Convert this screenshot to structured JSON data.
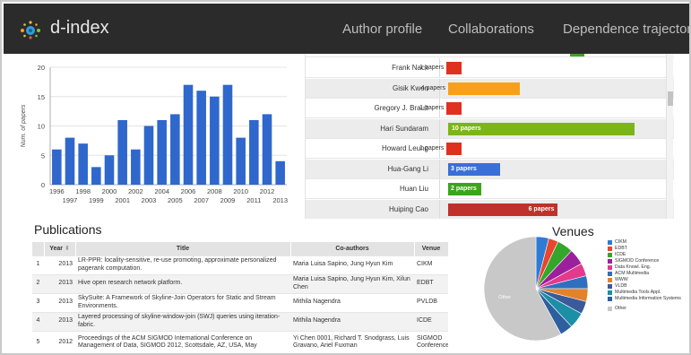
{
  "app": {
    "name": "d-index",
    "nav": [
      "Author profile",
      "Collaborations",
      "Dependence trajectory"
    ]
  },
  "chart_data": [
    {
      "type": "bar",
      "title": "",
      "xlabel": "",
      "ylabel": "Num. of papers",
      "ylim": [
        0,
        20
      ],
      "yticks": [
        0,
        5,
        10,
        15,
        20
      ],
      "grid": true,
      "categories": [
        "1996",
        "1997",
        "1998",
        "1999",
        "2000",
        "2001",
        "2002",
        "2003",
        "2004",
        "2005",
        "2006",
        "2007",
        "2008",
        "2009",
        "2010",
        "2011",
        "2012",
        "2013"
      ],
      "values": [
        6,
        8,
        7,
        3,
        5,
        11,
        6,
        10,
        11,
        12,
        17,
        16,
        15,
        17,
        8,
        11,
        12,
        4
      ],
      "color": "#2f67cc"
    },
    {
      "type": "bar",
      "orientation": "horizontal",
      "categories": [
        "Frank Nack",
        "Gisik Kwon",
        "Gregory J. Brault",
        "Hari Sundaram",
        "Howard Leung",
        "Hua-Gang Li",
        "Huan Liu",
        "Huiping Cao"
      ],
      "values": [
        1,
        4,
        1,
        10,
        1,
        3,
        2,
        6
      ],
      "labels": [
        "1 papers",
        "4 papers",
        "1 papers",
        "10 papers",
        "1 papers",
        "3 papers",
        "2 papers",
        "6 papers"
      ],
      "colors": [
        "#e0301e",
        "#f7a11a",
        "#e0301e",
        "#7cb518",
        "#e0301e",
        "#3a6fd8",
        "#3aa51a",
        "#c0312b"
      ]
    },
    {
      "type": "pie",
      "title": "Venues",
      "slices": [
        {
          "label": "CIKM",
          "color": "#2e7bd6",
          "value": 4
        },
        {
          "label": "EDBT",
          "color": "#e8462e",
          "value": 3
        },
        {
          "label": "ICDE",
          "color": "#34a62b",
          "value": 5
        },
        {
          "label": "SIGMOD Conference",
          "color": "#9c1f9c",
          "value": 5
        },
        {
          "label": "Data Knowl. Eng.",
          "color": "#e23a8c",
          "value": 4
        },
        {
          "label": "ACM Multimedia",
          "color": "#2f6fc0",
          "value": 4
        },
        {
          "label": "WWW",
          "color": "#e2822a",
          "value": 4
        },
        {
          "label": "VLDB",
          "color": "#3c5a9a",
          "value": 4
        },
        {
          "label": "Multimedia Tools Appl.",
          "color": "#1b8fa6",
          "value": 5
        },
        {
          "label": "Multimedia Information Systems",
          "color": "#2d5f9e",
          "value": 4
        },
        {
          "label": "Other",
          "color": "#c8c8c8",
          "value": 58
        }
      ],
      "other_label": "Other"
    }
  ],
  "publications": {
    "title": "Publications",
    "columns": [
      "",
      "Year",
      "Title",
      "Co-authors",
      "Venue"
    ],
    "sort_indicator": "⬍",
    "rows": [
      {
        "num": "1",
        "year": "2013",
        "title": "LR-PPR: locality-sensitive, re-use promoting, approximate personalized pagerank computation.",
        "coauthors": "Maria Luisa Sapino, Jung Hyun Kim",
        "venue": "CIKM"
      },
      {
        "num": "2",
        "year": "2013",
        "title": "Hive open research network platform.",
        "coauthors": "Maria Luisa Sapino, Jung Hyun Kim, Xilun Chen",
        "venue": "EDBT"
      },
      {
        "num": "3",
        "year": "2013",
        "title": "SkySuite: A Framework of Skyline-Join Operators for Static and Stream Environments.",
        "coauthors": "Mithila Nagendra",
        "venue": "PVLDB"
      },
      {
        "num": "4",
        "year": "2013",
        "title": "Layered processing of skyline-window-join (SWJ) queries using iteration-fabric.",
        "coauthors": "Mithila Nagendra",
        "venue": "ICDE"
      },
      {
        "num": "5",
        "year": "2012",
        "title": "Proceedings of the ACM SIGMOD International Conference on Management of Data, SIGMOD 2012, Scottsdale, AZ, USA, May",
        "coauthors": "Yi Chen 0001, Richard T. Snodgrass, Luis Gravano, Ariel Fuxman",
        "venue": "SIGMOD Conference"
      }
    ]
  },
  "venues": {
    "title": "Venues"
  },
  "icons": {
    "logo": "dots-logo-icon"
  },
  "colors": {
    "navbar": "#2b2b2b",
    "accent": "#2f67cc"
  }
}
